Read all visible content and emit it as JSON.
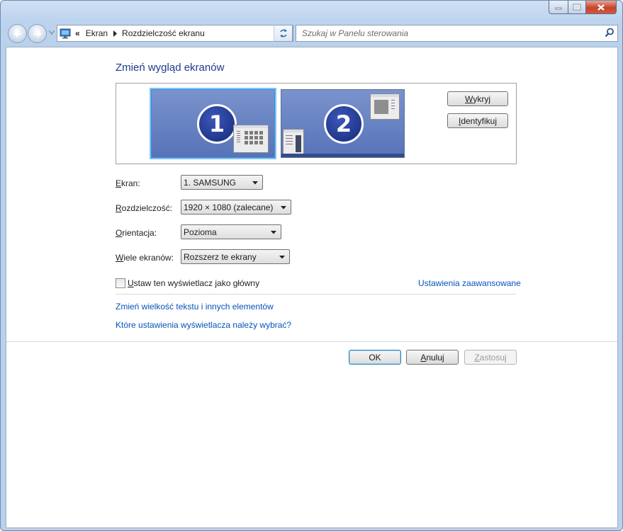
{
  "window": {
    "caption_buttons": {
      "minimize_icon": "minimize-icon",
      "maximize_icon": "maximize-icon",
      "close_icon": "close-icon"
    }
  },
  "nav": {
    "prefix": "«",
    "breadcrumb": [
      "Ekran",
      "Rozdzielczość ekranu"
    ],
    "search_placeholder": "Szukaj w Panelu sterowania"
  },
  "main": {
    "title": "Zmień wygląd ekranów",
    "monitors": [
      {
        "number": "1",
        "selected": true
      },
      {
        "number": "2",
        "selected": false
      }
    ],
    "detect_button": {
      "hotkey": "W",
      "rest": "ykryj"
    },
    "identify_button": {
      "hotkey": "I",
      "rest": "dentyfikuj"
    },
    "fields": {
      "display": {
        "hotkey": "E",
        "label_rest": "kran:",
        "value": "1. SAMSUNG"
      },
      "resolution": {
        "hotkey": "R",
        "label_rest": "ozdzielczość:",
        "value": "1920 × 1080 (zalecane)"
      },
      "orientation": {
        "hotkey": "O",
        "label_rest": "rientacja:",
        "value": "Pozioma"
      },
      "multiple": {
        "hotkey": "W",
        "label_rest": "iele ekranów:",
        "value": "Rozszerz te ekrany"
      }
    },
    "primary_checkbox": {
      "hotkey": "U",
      "label_rest": "staw ten wyświetlacz jako główny",
      "checked": false
    },
    "advanced_link": "Ustawienia zaawansowane",
    "links": [
      "Zmień wielkość tekstu i innych elementów",
      "Które ustawienia wyświetlacza należy wybrać?"
    ]
  },
  "buttons": {
    "ok": "OK",
    "cancel": {
      "hotkey": "A",
      "before": "",
      "rest": "nuluj"
    },
    "apply": {
      "before": "",
      "hotkey": "Z",
      "rest": "astosuj",
      "disabled": true
    }
  },
  "colors": {
    "link": "#0654b8",
    "title": "#1e3a8a",
    "monitor_fill": "#6984c4"
  }
}
